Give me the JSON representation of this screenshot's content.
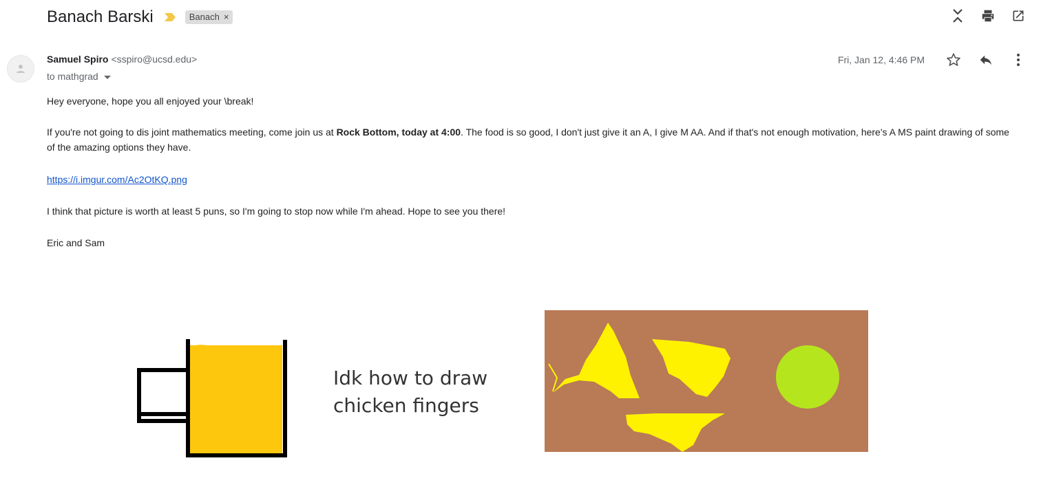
{
  "thread": {
    "subject": "Banach Barski",
    "label_chip": "Banach",
    "label_remove": "×"
  },
  "top_icons": [
    "collapse-all-icon",
    "print-icon",
    "open-in-new-window-icon"
  ],
  "message": {
    "sender_name": "Samuel Spiro",
    "sender_email": "<sspiro@ucsd.edu>",
    "to_line": "to mathgrad",
    "date": "Fri, Jan 12, 4:46 PM",
    "header_icons": [
      "star-icon",
      "reply-icon",
      "more-vert-icon"
    ]
  },
  "body": {
    "p1": "Hey everyone, hope you all enjoyed your \\break!",
    "p2_a": "If you're not going to dis joint mathematics meeting, come join us at ",
    "p2_bold": "Rock Bottom, today at 4:00",
    "p2_b": ".  The food is so good, I don't just give it an A, I give M AA.  And if that's not enough motivation, here's A MS paint drawing of some of the amazing options they have.",
    "link": "https://i.imgur.com/Ac2OtKQ.png",
    "p4": "I think that picture is worth at least 5 puns, so I'm going to stop now while I'm ahead.  Hope to see you there!",
    "p5": "Eric and Sam"
  },
  "drawing": {
    "caption_line1": "Idk how to draw",
    "caption_line2": "chicken fingers",
    "colors": {
      "beer": "#fdc70e",
      "plate": "#b97a56",
      "chip": "#fff200",
      "lime": "#b5e61d",
      "outline": "#000000"
    }
  }
}
